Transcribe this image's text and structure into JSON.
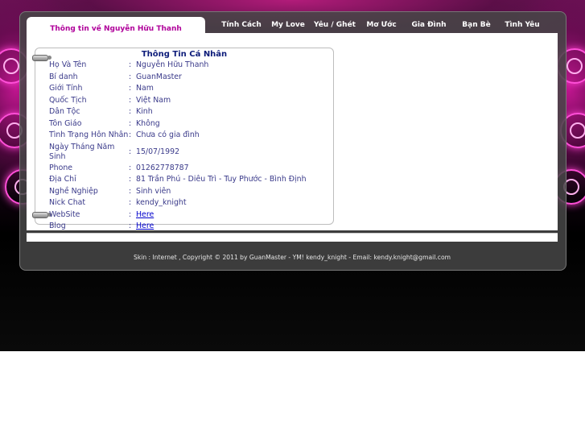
{
  "title_tab": "Thông tin về Nguyễn Hữu Thanh",
  "nav": [
    {
      "label": "Tính Cách"
    },
    {
      "label": "My Love"
    },
    {
      "label": "Yêu / Ghét"
    },
    {
      "label": "Mơ Ước"
    },
    {
      "label": "Gia Đình"
    },
    {
      "label": "Bạn Bè"
    },
    {
      "label": "Tình Yêu"
    }
  ],
  "info": {
    "title": "Thông Tin Cá Nhân",
    "rows": [
      {
        "label": "Họ Và Tên",
        "value": "Nguyễn Hữu Thanh"
      },
      {
        "label": "Bí danh",
        "value": "GuanMaster"
      },
      {
        "label": "Giới Tính",
        "value": "Nam"
      },
      {
        "label": "Quốc Tịch",
        "value": "Việt Nam"
      },
      {
        "label": "Dân Tộc",
        "value": "Kinh"
      },
      {
        "label": "Tôn Giáo",
        "value": "Không"
      },
      {
        "label": "Tình Trạng Hôn Nhân",
        "value": "Chưa có gia đình"
      },
      {
        "label": "Ngày Tháng Năm Sinh",
        "value": "15/07/1992"
      },
      {
        "label": "Phone",
        "value": "01262778787"
      },
      {
        "label": "Địa Chỉ",
        "value": "81 Trần Phú - Diêu Trì - Tuy Phước - Bình Định"
      },
      {
        "label": "Nghề Nghiệp",
        "value": "Sinh viên"
      },
      {
        "label": "Nick Chat",
        "value": "kendy_knight"
      },
      {
        "label": "WebSite",
        "value": "Here"
      },
      {
        "label": "Blog",
        "value": "Here"
      }
    ],
    "colon": ":"
  },
  "footer": "Skin : Internet , Copyright © 2011 by GuanMaster - YM! kendy_knight - Email: kendy.knight@gmail.com"
}
